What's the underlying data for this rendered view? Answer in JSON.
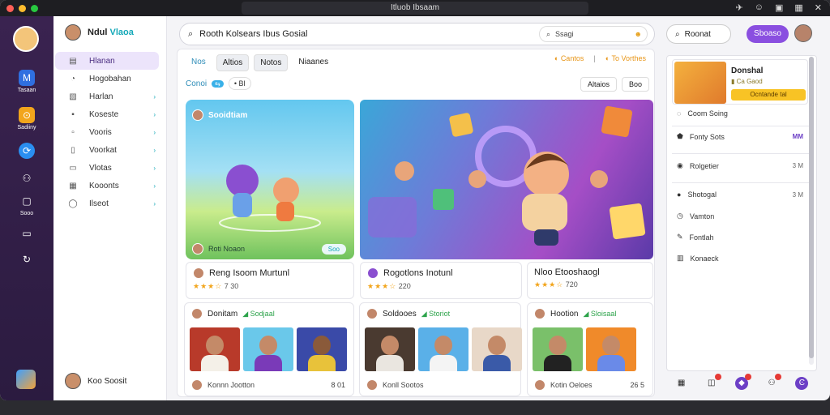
{
  "window": {
    "title": "Itluob Ibsaam"
  },
  "titlebar_icons": [
    "pin-icon",
    "face-icon",
    "square-icon",
    "grid-icon",
    "close-icon"
  ],
  "rail": {
    "items": [
      {
        "label": "Tasaan",
        "icon": "chart-icon",
        "glyph": "M"
      },
      {
        "label": "Sadiiny",
        "icon": "chat-icon",
        "glyph": "⊙"
      },
      {
        "label": "",
        "icon": "sync-icon",
        "glyph": "⟳"
      },
      {
        "label": "",
        "icon": "people-icon",
        "glyph": "⚇"
      },
      {
        "label": "Sooo",
        "icon": "board-icon",
        "glyph": "▢"
      },
      {
        "label": "",
        "icon": "monitor-icon",
        "glyph": "▭"
      },
      {
        "label": "",
        "icon": "refresh-icon",
        "glyph": "↻"
      }
    ]
  },
  "sidebar": {
    "title_a": "Ndul",
    "title_b": "Vlaoa",
    "items": [
      {
        "label": "Hlanan",
        "glyph": "▤",
        "active": true,
        "chev": false
      },
      {
        "label": "Hogobahan",
        "glyph": "◔",
        "active": false,
        "chev": false
      },
      {
        "label": "Harlan",
        "glyph": "▧",
        "active": false,
        "chev": true
      },
      {
        "label": "Koseste",
        "glyph": "▪",
        "active": false,
        "chev": true
      },
      {
        "label": "Vooris",
        "glyph": "▫",
        "active": false,
        "chev": true
      },
      {
        "label": "Voorkat",
        "glyph": "▯",
        "active": false,
        "chev": true
      },
      {
        "label": "Vlotas",
        "glyph": "▭",
        "active": false,
        "chev": true
      },
      {
        "label": "Kooonts",
        "glyph": "▦",
        "active": false,
        "chev": true
      },
      {
        "label": "Ilseot",
        "glyph": "◯",
        "active": false,
        "chev": true
      }
    ],
    "footer": "Koo Soosit"
  },
  "search": {
    "query": "Rooth Kolsears Ibus Gosial",
    "inner": "Ssagi"
  },
  "header_right": {
    "button1": "Roonat",
    "button2": "Sboaso"
  },
  "tabs": {
    "items": [
      "Nos",
      "Altios",
      "Notos",
      "Niaanes"
    ],
    "right_a": "Cantos",
    "right_b": "To Vorthes"
  },
  "filters": {
    "label": "Conoi",
    "badge": "⇆",
    "chip": "• Bl",
    "btn1": "Altaios",
    "btn2": "Boo"
  },
  "hero1": {
    "tag": "Sooidtiam",
    "foot": "Roti Noaon",
    "button": "Soo"
  },
  "cards": [
    {
      "title": "Reng Isoom Murtunl",
      "rating": "7 30"
    },
    {
      "title": "Rogotlons Inotunl",
      "rating": "220"
    },
    {
      "title": "Nloo Etooshaogl",
      "rating": "720"
    }
  ],
  "vcards": [
    {
      "title": "Donitam",
      "tag": "Sodjaal",
      "foot": "Konnn Jootton",
      "meta": "8 01"
    },
    {
      "title": "Soldooes",
      "tag": "Storiot",
      "foot": "Konll Sootos",
      "meta": ""
    },
    {
      "title": "Hootion",
      "tag": "Sloisaal",
      "foot": "Kotin Oeloes",
      "meta": "26 5"
    }
  ],
  "rpanel": {
    "promo_title": "Donshal",
    "promo_sub": "Ca Gaod",
    "promo_btn": "Ocntande tal",
    "rows": [
      {
        "label": "Coom Soing",
        "val": "",
        "icon": "speech-icon",
        "glyph": "◌",
        "purple": false
      },
      {
        "label": "Fonty Sots",
        "val": "MM",
        "icon": "shield-icon",
        "glyph": "⬟",
        "purple": true
      },
      {
        "label": "Rolgetier",
        "val": "3 M",
        "icon": "ring-icon",
        "glyph": "◉",
        "purple": false
      },
      {
        "label": "Shotogal",
        "val": "3 M",
        "icon": "coin-icon",
        "glyph": "●",
        "purple": false
      },
      {
        "label": "Vamton",
        "val": "",
        "icon": "clock-icon",
        "glyph": "◷",
        "purple": false
      },
      {
        "label": "Fontlah",
        "val": "",
        "icon": "mic-icon",
        "glyph": "✎",
        "purple": false
      },
      {
        "label": "Konaeck",
        "val": "",
        "icon": "book-icon",
        "glyph": "▥",
        "purple": false
      }
    ]
  },
  "colors": {
    "accent": "#8a4fe0",
    "teal": "#14a8b8",
    "star": "#f2a51c",
    "rail": "#3a2350"
  }
}
